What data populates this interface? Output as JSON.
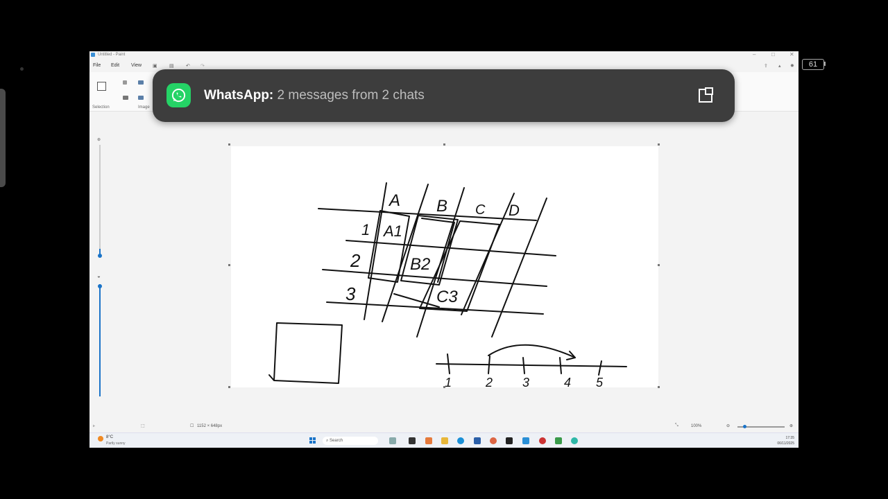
{
  "window": {
    "title": "Untitled - Paint"
  },
  "menu": {
    "file": "File",
    "edit": "Edit",
    "view": "View"
  },
  "ribbon": {
    "selection_label": "Selection",
    "image_label": "Image"
  },
  "status": {
    "canvas_size": "1152 × 648px",
    "zoom": "100%"
  },
  "taskbar": {
    "weather_temp": "8°C",
    "weather_desc": "Partly sunny",
    "search_placeholder": "Search",
    "time": "17:35",
    "date": "06/11/2025"
  },
  "device": {
    "battery": "61"
  },
  "notification": {
    "app": "WhatsApp:",
    "message": "2 messages from 2 chats"
  },
  "drawing": {
    "column_labels": [
      "A",
      "B",
      "C",
      "D"
    ],
    "row_labels": [
      "1",
      "2",
      "3"
    ],
    "cell_labels": [
      "A1",
      "B2",
      "C3"
    ],
    "numberline_labels": [
      "1",
      "2",
      "3",
      "4",
      "5"
    ]
  },
  "colors": {
    "whatsapp_green": "#25d366",
    "notification_bg": "#3d3d3d",
    "accent_blue": "#1a73c8"
  }
}
